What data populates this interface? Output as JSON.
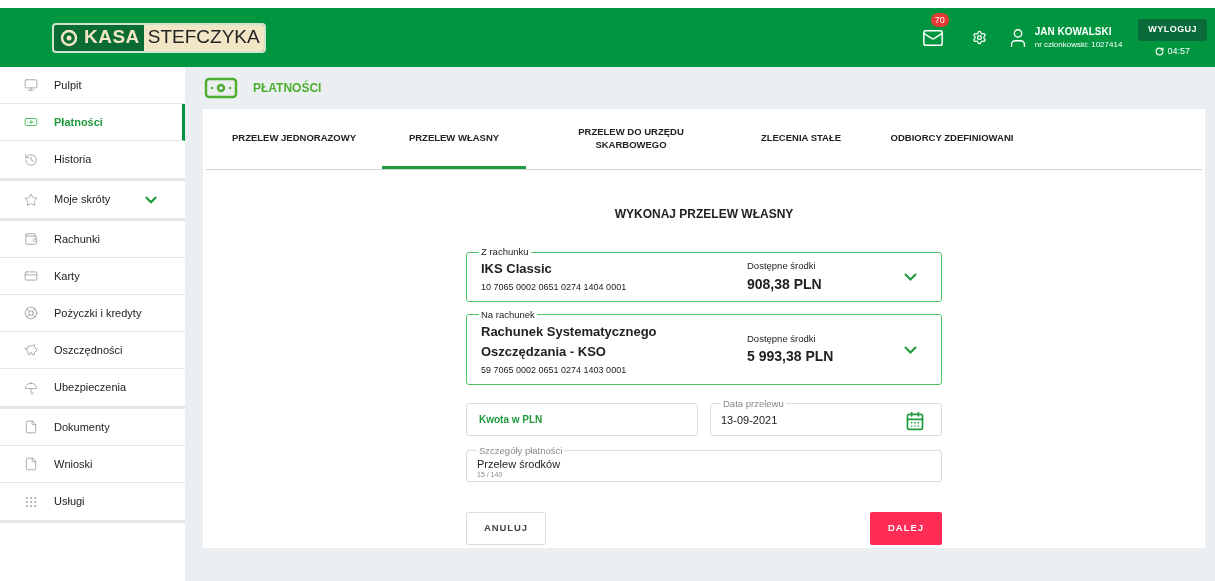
{
  "header": {
    "logo": {
      "left": "KASA",
      "right": "STEFCZYKA"
    },
    "messages_badge": "70",
    "user": {
      "name": "JAN KOWALSKI",
      "member": "nr członkowski: 1027414"
    },
    "logout": "WYLOGUJ",
    "timer": "04:57"
  },
  "sidebar": {
    "groups": [
      [
        {
          "label": "Pulpit",
          "selected": false
        },
        {
          "label": "Płatności",
          "selected": true
        },
        {
          "label": "Historia",
          "selected": false
        }
      ],
      [
        {
          "label": "Moje skróty",
          "selected": false
        }
      ],
      [
        {
          "label": "Rachunki",
          "selected": false
        },
        {
          "label": "Karty",
          "selected": false
        },
        {
          "label": "Pożyczki i kredyty",
          "selected": false
        },
        {
          "label": "Oszczędności",
          "selected": false
        },
        {
          "label": "Ubezpieczenia",
          "selected": false
        }
      ],
      [
        {
          "label": "Dokumenty",
          "selected": false
        },
        {
          "label": "Wnioski",
          "selected": false
        },
        {
          "label": "Usługi",
          "selected": false
        }
      ]
    ]
  },
  "page_title": "PŁATNOŚCI",
  "tabs": [
    {
      "label": "PRZELEW JEDNORAZOWY",
      "selected": false
    },
    {
      "label": "PRZELEW WŁASNY",
      "selected": true
    },
    {
      "label": "PRZELEW DO URZĘDU SKARBOWEGO",
      "selected": false
    },
    {
      "label": "ZLECENIA STAŁE",
      "selected": false
    },
    {
      "label": "ODBIORCY ZDEFINIOWANI",
      "selected": false
    }
  ],
  "form": {
    "title": "WYKONAJ PRZELEW WŁASNY",
    "accounts": [
      {
        "legend": "Z rachunku",
        "name": "IKS Classic",
        "number": "10 7065 0002 0651 0274 1404 0001",
        "funds_label": "Dostępne środki",
        "funds": "908,38 PLN"
      },
      {
        "legend": "Na rachunek",
        "name": "Rachunek Systematycznego Oszczędzania - KSO",
        "number": "59 7065 0002 0651 0274 1403 0001",
        "funds_label": "Dostępne środki",
        "funds": "5 993,38 PLN"
      }
    ],
    "amount": {
      "placeholder": "Kwota w PLN"
    },
    "date": {
      "label": "Data przelewu",
      "value": "13-09-2021"
    },
    "details": {
      "label": "Szczegóły płatności",
      "value": "Przelew środków",
      "counter": "15 / 140"
    },
    "buttons": {
      "cancel": "ANULUJ",
      "next": "DALEJ"
    }
  }
}
